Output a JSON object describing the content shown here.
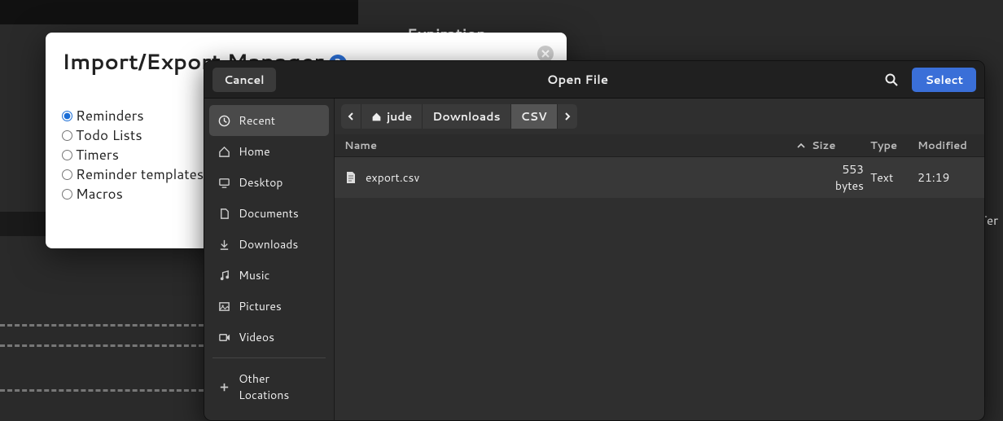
{
  "background": {
    "expiration_label": "Expiration",
    "ter_label": "Ter"
  },
  "import_export": {
    "title": "Import/Export Manager",
    "options": [
      {
        "label": "Reminders",
        "checked": true
      },
      {
        "label": "Todo Lists",
        "checked": false
      },
      {
        "label": "Timers",
        "checked": false
      },
      {
        "label": "Reminder templates",
        "checked": false
      },
      {
        "label": "Macros",
        "checked": false
      }
    ]
  },
  "file_dialog": {
    "cancel": "Cancel",
    "title": "Open File",
    "select": "Select",
    "sidebar": {
      "recent": "Recent",
      "home": "Home",
      "desktop": "Desktop",
      "documents": "Documents",
      "downloads": "Downloads",
      "music": "Music",
      "pictures": "Pictures",
      "videos": "Videos",
      "other": "Other Locations"
    },
    "path": {
      "root": "jude",
      "p1": "Downloads",
      "p2": "CSV"
    },
    "columns": {
      "name": "Name",
      "size": "Size",
      "type": "Type",
      "modified": "Modified"
    },
    "rows": [
      {
        "name": "export.csv",
        "size": "553 bytes",
        "type": "Text",
        "modified": "21:19"
      }
    ]
  }
}
